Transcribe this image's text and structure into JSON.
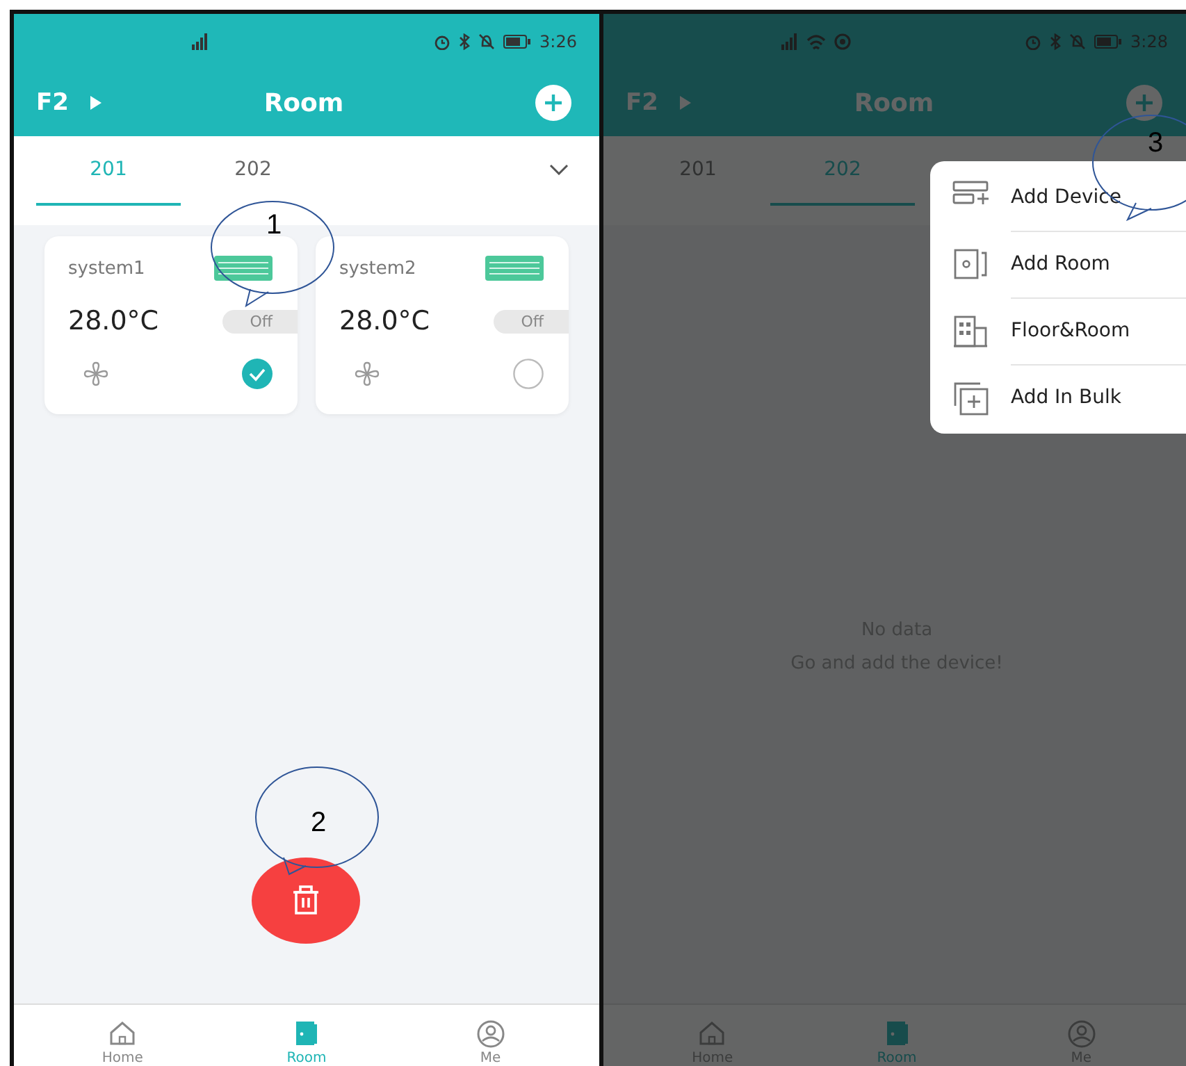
{
  "screens": [
    {
      "status_bar": {
        "time": "3:26",
        "left_icons": [
          {
            "kind": "signal"
          }
        ]
      },
      "top_bar": {
        "floor": "F2",
        "title": "Room"
      },
      "room_tabs": [
        {
          "label": "201",
          "selected": true
        },
        {
          "label": "202",
          "selected": false
        }
      ],
      "devices": [
        {
          "name": "system1",
          "temperature": "28.0°C",
          "power": "Off",
          "selected": true,
          "callout": "1"
        },
        {
          "name": "system2",
          "temperature": "28.0°C",
          "power": "Off",
          "selected": false
        }
      ],
      "delete_button": {
        "callout": "2"
      },
      "dimmed": false,
      "nav": [
        {
          "label": "Home",
          "kind": "home",
          "selected": false
        },
        {
          "label": "Room",
          "kind": "room",
          "selected": true
        },
        {
          "label": "Me",
          "kind": "me",
          "selected": false
        }
      ]
    },
    {
      "status_bar": {
        "time": "3:28",
        "left_icons": [
          {
            "kind": "signal"
          },
          {
            "kind": "wifi"
          },
          {
            "kind": "hotspot"
          }
        ]
      },
      "top_bar": {
        "floor": "F2",
        "title": "Room",
        "add_callout": "3"
      },
      "room_tabs": [
        {
          "label": "201",
          "selected": false
        },
        {
          "label": "202",
          "selected": true
        }
      ],
      "empty_state": [
        "No data",
        "Go and add the device!"
      ],
      "dimmed": true,
      "menu": [
        {
          "label": "Add Device",
          "kind": "device"
        },
        {
          "label": "Add Room",
          "kind": "room"
        },
        {
          "label": "Floor&Room",
          "kind": "building"
        },
        {
          "label": "Add In Bulk",
          "kind": "bulk"
        }
      ],
      "nav": [
        {
          "label": "Home",
          "kind": "home",
          "selected": false
        },
        {
          "label": "Room",
          "kind": "room",
          "selected": true
        },
        {
          "label": "Me",
          "kind": "me",
          "selected": false
        }
      ]
    }
  ]
}
